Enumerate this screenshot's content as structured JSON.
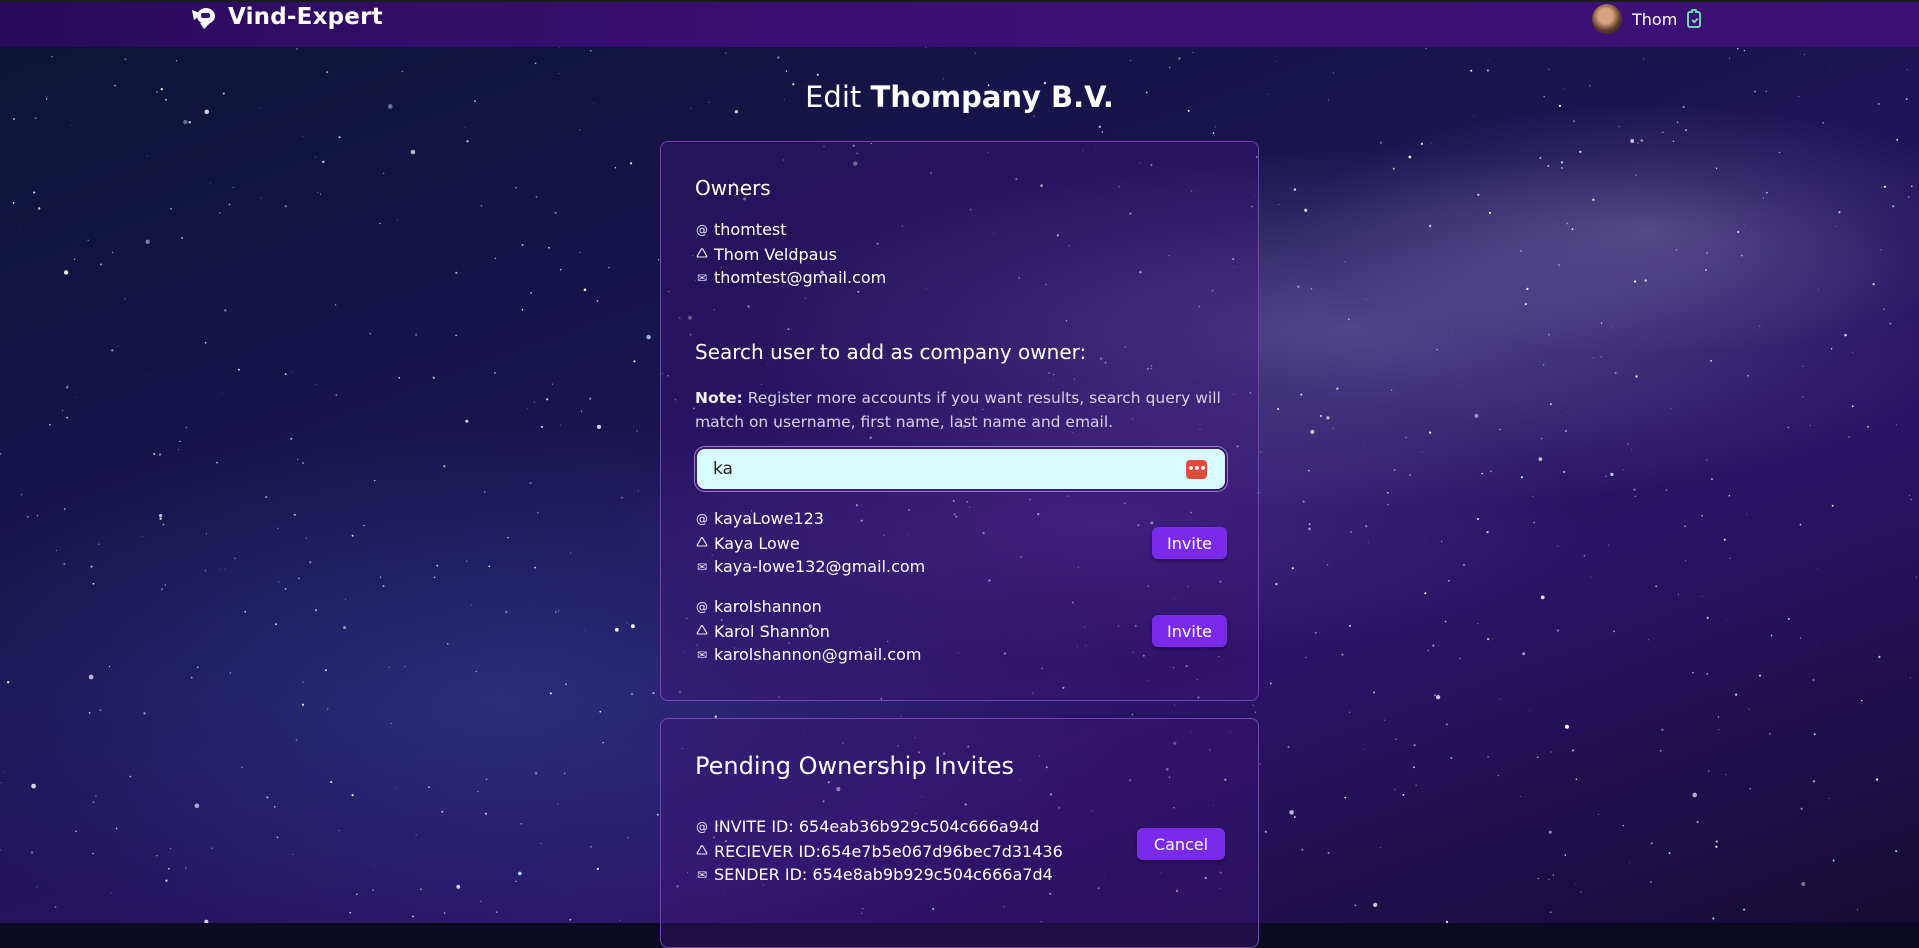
{
  "header": {
    "app_name": "Vind-Expert",
    "user_name": "Thom",
    "logo_icon": "astronaut-logo-icon",
    "clipboard_icon": "clipboard-check-icon"
  },
  "page": {
    "title_prefix": "Edit",
    "company_name": "Thompany B.V."
  },
  "owners": {
    "heading": "Owners",
    "list": [
      {
        "username": "thomtest",
        "full_name": "Thom Veldpaus",
        "email": "thomtest@gmail.com"
      }
    ]
  },
  "search": {
    "heading": "Search user to add as company owner:",
    "note_label": "Note:",
    "note_text": "Register more accounts if you want results, search query will match on username, first name, last name and email.",
    "value": "ka",
    "results": [
      {
        "username": "kayaLowe123",
        "full_name": "Kaya Lowe",
        "email": "kaya-lowe132@gmail.com",
        "action": "Invite"
      },
      {
        "username": "karolshannon",
        "full_name": "Karol Shannon",
        "email": "karolshannon@gmail.com",
        "action": "Invite"
      }
    ]
  },
  "pending": {
    "heading": "Pending Ownership Invites",
    "invites": [
      {
        "invite_id": "INVITE ID: 654eab36b929c504c666a94d",
        "receiver_id": "RECIEVER ID:654e7b5e067d96bec7d31436",
        "sender_id": "SENDER ID: 654e8ab9b929c504c666a7d4",
        "action": "Cancel"
      }
    ]
  },
  "colors": {
    "topbar": "#3a0f73",
    "button": "#7a2bea",
    "card_border": "#7a3fb8",
    "search_bg": "#d8fbfd"
  }
}
